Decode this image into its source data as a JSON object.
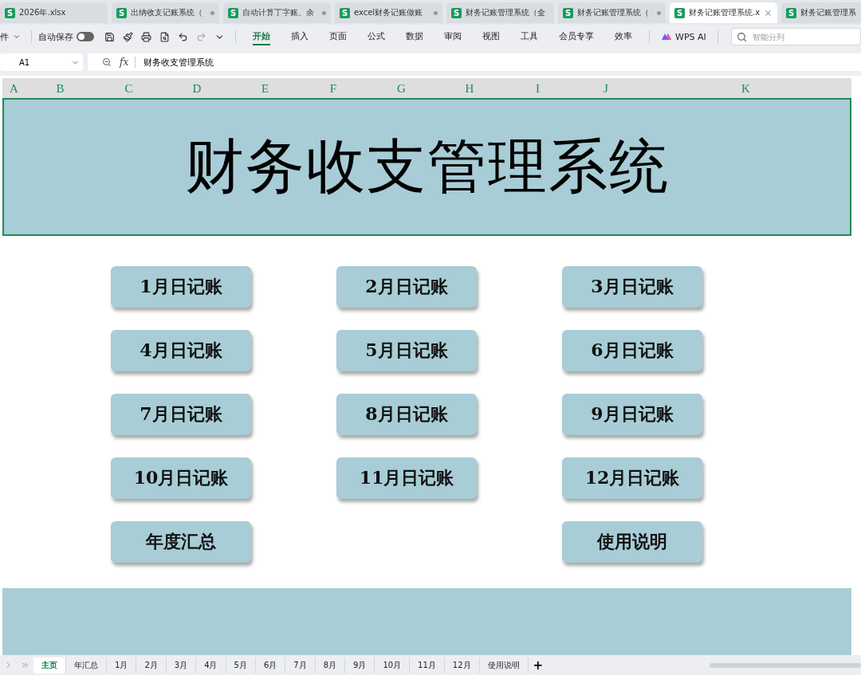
{
  "doc_tabs": [
    {
      "badge": "S",
      "label": "2026年.xlsx",
      "selected": false,
      "unsaved": false
    },
    {
      "badge": "S",
      "label": "出纳收支记账系统（",
      "selected": false,
      "unsaved": true
    },
    {
      "badge": "S",
      "label": "自动计算丁字账、余",
      "selected": false,
      "unsaved": true
    },
    {
      "badge": "S",
      "label": "excel财务记账做账",
      "selected": false,
      "unsaved": true
    },
    {
      "badge": "S",
      "label": "财务记账管理系统（全",
      "selected": false,
      "unsaved": false
    },
    {
      "badge": "S",
      "label": "财务记账管理系统（",
      "selected": false,
      "unsaved": true
    },
    {
      "badge": "S",
      "label": "财务记账管理系统.x",
      "selected": true,
      "unsaved": false
    },
    {
      "badge": "S",
      "label": "财务记账管理系",
      "selected": false,
      "unsaved": false
    }
  ],
  "toolbar": {
    "file_menu": "件",
    "autosave": {
      "label": "自动保存",
      "on": false
    },
    "ribbon_tabs": [
      {
        "label": "开始",
        "selected": true
      },
      {
        "label": "插入",
        "selected": false
      },
      {
        "label": "页面",
        "selected": false
      },
      {
        "label": "公式",
        "selected": false
      },
      {
        "label": "数据",
        "selected": false
      },
      {
        "label": "审阅",
        "selected": false
      },
      {
        "label": "视图",
        "selected": false
      },
      {
        "label": "工具",
        "selected": false
      },
      {
        "label": "会员专享",
        "selected": false
      },
      {
        "label": "效率",
        "selected": false
      }
    ],
    "ai_button": "WPS AI",
    "search": {
      "placeholder": "智能分列"
    }
  },
  "formula_bar": {
    "cell": "A1",
    "fx": "fx",
    "value": "财务收支管理系统"
  },
  "columns": [
    "A",
    "B",
    "C",
    "D",
    "E",
    "F",
    "G",
    "H",
    "I",
    "J",
    "K"
  ],
  "sheet": {
    "title": "财务收支管理系统",
    "button_rows": [
      {
        "left": "1月日记账",
        "center": "2月日记账",
        "right": "3月日记账"
      },
      {
        "left": "4月日记账",
        "center": "5月日记账",
        "right": "6月日记账"
      },
      {
        "left": "7月日记账",
        "center": "8月日记账",
        "right": "9月日记账"
      },
      {
        "left": "10月日记账",
        "center": "11月日记账",
        "right": "12月日记账"
      },
      {
        "left": "年度汇总",
        "right": "使用说明"
      }
    ]
  },
  "sheet_tabs": [
    {
      "label": "主页",
      "selected": true
    },
    {
      "label": "年汇总",
      "selected": false
    },
    {
      "label": "1月",
      "selected": false
    },
    {
      "label": "2月",
      "selected": false
    },
    {
      "label": "3月",
      "selected": false
    },
    {
      "label": "4月",
      "selected": false
    },
    {
      "label": "5月",
      "selected": false
    },
    {
      "label": "6月",
      "selected": false
    },
    {
      "label": "7月",
      "selected": false
    },
    {
      "label": "8月",
      "selected": false
    },
    {
      "label": "9月",
      "selected": false
    },
    {
      "label": "10月",
      "selected": false
    },
    {
      "label": "11月",
      "selected": false
    },
    {
      "label": "12月",
      "selected": false
    },
    {
      "label": "使用说明",
      "selected": false
    }
  ],
  "add_sheet": "+"
}
